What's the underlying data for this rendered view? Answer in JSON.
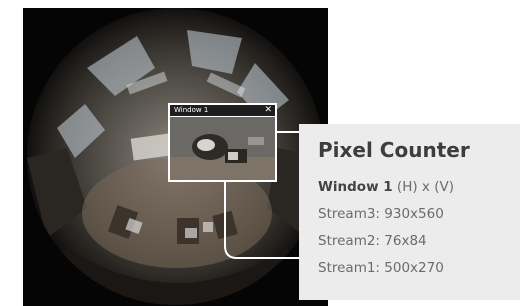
{
  "camera": {
    "window": {
      "title": "Window 1",
      "close_glyph": "✕"
    }
  },
  "panel": {
    "title": "Pixel Counter",
    "window_label": "Window 1",
    "dimension_hint": " (H) x (V)",
    "streams": [
      "Stream3: 930x560",
      "Stream2: 76x84",
      "Stream1: 500x270"
    ]
  },
  "colors": {
    "panel_background": "#ececec",
    "title_text": "#3d3d3d",
    "body_text": "#6b6b6b",
    "window_border": "#ffffff",
    "camera_background": "#050505"
  }
}
